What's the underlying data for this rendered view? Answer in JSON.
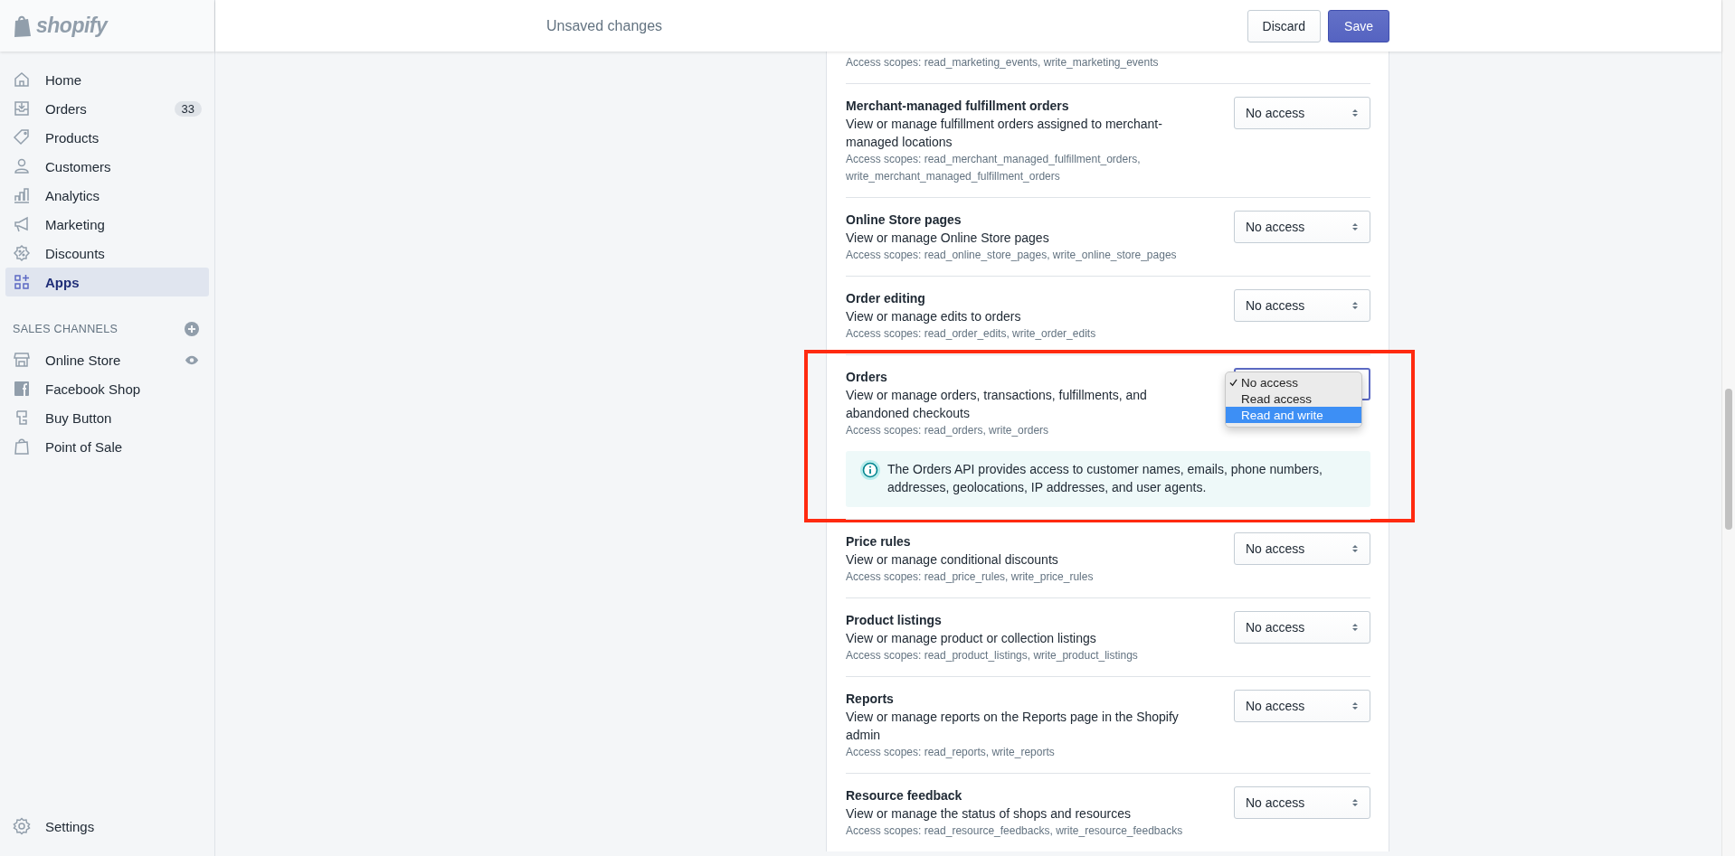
{
  "brand": "shopify",
  "top_bar": {
    "title": "Unsaved changes",
    "buttons": [
      {
        "label": "Discard",
        "kind": "secondary"
      },
      {
        "label": "Save",
        "kind": "primary"
      }
    ]
  },
  "sidebar": {
    "items": [
      {
        "label": "Home",
        "selected": false
      },
      {
        "label": "Orders",
        "badge": "33",
        "selected": false
      },
      {
        "label": "Products",
        "selected": false
      },
      {
        "label": "Customers",
        "selected": false
      },
      {
        "label": "Analytics",
        "selected": false
      },
      {
        "label": "Marketing",
        "selected": false
      },
      {
        "label": "Discounts",
        "selected": false
      },
      {
        "label": "Apps",
        "selected": true
      }
    ],
    "section": {
      "title": "SALES CHANNELS",
      "items": [
        {
          "label": "Online Store"
        },
        {
          "label": "Facebook Shop"
        },
        {
          "label": "Buy Button"
        },
        {
          "label": "Point of Sale"
        }
      ]
    },
    "footer": {
      "label": "Settings"
    }
  },
  "permissions": [
    {
      "scopes": "Access scopes: read_marketing_events, write_marketing_events"
    },
    {
      "title": "Merchant-managed fulfillment orders",
      "description": "View or manage fulfillment orders assigned to merchant-managed locations",
      "scopes": "Access scopes: read_merchant_managed_fulfillment_orders, write_merchant_managed_fulfillment_orders",
      "value": "No access",
      "focused": false
    },
    {
      "title": "Online Store pages",
      "description": "View or manage Online Store pages",
      "scopes": "Access scopes: read_online_store_pages, write_online_store_pages",
      "value": "No access",
      "focused": false
    },
    {
      "title": "Order editing",
      "description": "View or manage edits to orders",
      "scopes": "Access scopes: read_order_edits, write_order_edits",
      "value": "No access",
      "focused": false
    },
    {
      "title": "Orders",
      "description": "View or manage orders, transactions, fulfillments, and abandoned checkouts",
      "scopes": "Access scopes: read_orders, write_orders",
      "focused": true,
      "annotated": true,
      "menu": [
        {
          "label": "No access",
          "checked": true,
          "highlighted": false
        },
        {
          "label": "Read access",
          "checked": false,
          "highlighted": false
        },
        {
          "label": "Read and write",
          "checked": false,
          "highlighted": true
        }
      ],
      "notice": "The Orders API provides access to customer names, emails, phone numbers, addresses, geolocations, IP addresses, and user agents."
    },
    {
      "title": "Price rules",
      "description": "View or manage conditional discounts",
      "scopes": "Access scopes: read_price_rules, write_price_rules",
      "value": "No access",
      "focused": false
    },
    {
      "title": "Product listings",
      "description": "View or manage product or collection listings",
      "scopes": "Access scopes: read_product_listings, write_product_listings",
      "value": "No access",
      "focused": false
    },
    {
      "title": "Reports",
      "description": "View or manage reports on the Reports page in the Shopify admin",
      "scopes": "Access scopes: read_reports, write_reports",
      "value": "No access",
      "focused": false
    },
    {
      "title": "Resource feedback",
      "description": "View or manage the status of shops and resources",
      "scopes": "Access scopes: read_resource_feedbacks, write_resource_feedbacks",
      "value": "No access",
      "focused": false
    }
  ]
}
